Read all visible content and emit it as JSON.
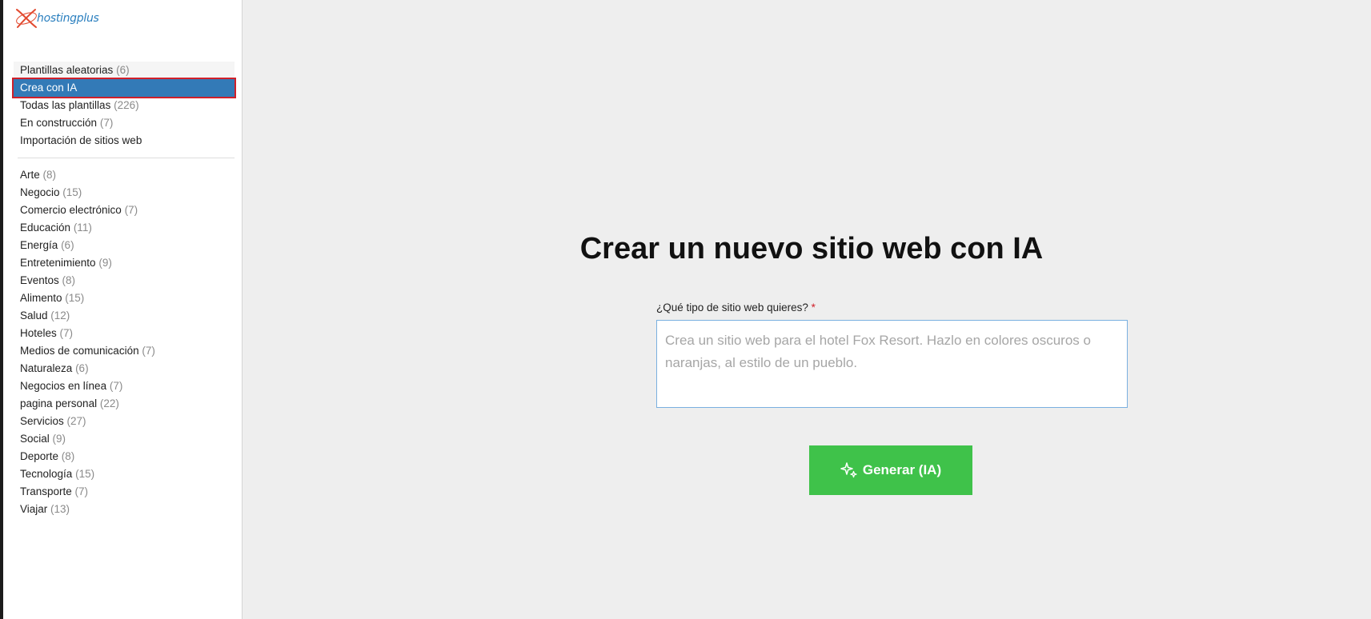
{
  "brand": {
    "logo_text": "hostingplus",
    "logo_icon": "hostingplus-x-logo",
    "logo_color": "#2a7fbf",
    "logo_accent": "#e2492f"
  },
  "sidebar": {
    "items": [
      {
        "label": "Plantillas aleatorias",
        "count": "(6)"
      },
      {
        "label": "Crea con IA",
        "count": ""
      },
      {
        "label": "Todas las plantillas",
        "count": "(226)"
      },
      {
        "label": "En construcción",
        "count": "(7)"
      },
      {
        "label": "Importación de sitios web",
        "count": ""
      }
    ],
    "categories": [
      {
        "label": "Arte",
        "count": "(8)"
      },
      {
        "label": "Negocio",
        "count": "(15)"
      },
      {
        "label": "Comercio electrónico",
        "count": "(7)"
      },
      {
        "label": "Educación",
        "count": "(11)"
      },
      {
        "label": "Energía",
        "count": "(6)"
      },
      {
        "label": "Entretenimiento",
        "count": "(9)"
      },
      {
        "label": "Eventos",
        "count": "(8)"
      },
      {
        "label": "Alimento",
        "count": "(15)"
      },
      {
        "label": "Salud",
        "count": "(12)"
      },
      {
        "label": "Hoteles",
        "count": "(7)"
      },
      {
        "label": "Medios de comunicación",
        "count": "(7)"
      },
      {
        "label": "Naturaleza",
        "count": "(6)"
      },
      {
        "label": "Negocios en línea",
        "count": "(7)"
      },
      {
        "label": "pagina personal",
        "count": "(22)"
      },
      {
        "label": "Servicios",
        "count": "(27)"
      },
      {
        "label": "Social",
        "count": "(9)"
      },
      {
        "label": "Deporte",
        "count": "(8)"
      },
      {
        "label": "Tecnología",
        "count": "(15)"
      },
      {
        "label": "Transporte",
        "count": "(7)"
      },
      {
        "label": "Viajar",
        "count": "(13)"
      }
    ],
    "active_color": "#337ab7",
    "highlight_color": "#d0202a"
  },
  "main": {
    "title": "Crear un nuevo sitio web con IA",
    "field_label": "¿Qué tipo de sitio web quieres?",
    "required_mark": "*",
    "prompt_value": "",
    "prompt_placeholder": "Crea un sitio web para el hotel Fox Resort. Hazlo en colores oscuros o naranjas, al estilo de un pueblo.",
    "generate_label": "Generar (IA)",
    "generate_icon": "sparkle-icon",
    "generate_color": "#3fc24a"
  }
}
